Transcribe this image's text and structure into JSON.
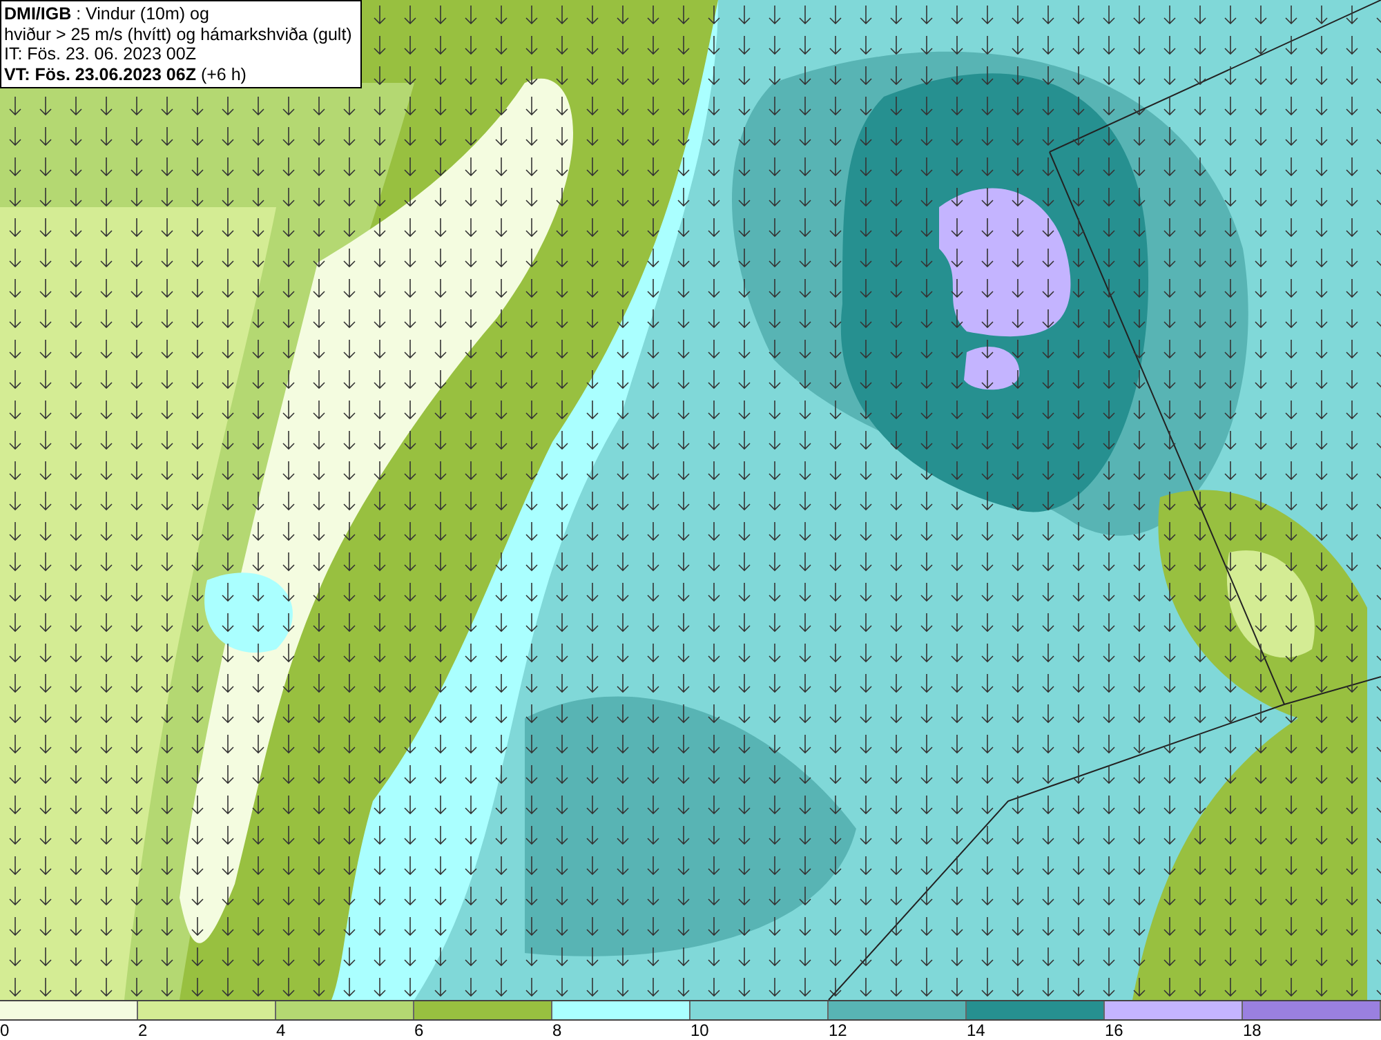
{
  "title_box": {
    "lines": [
      "**DMI/IGB** : Vindur (10m) og",
      "hviður > 25 m/s (hvítt) og hámarkshviða (gult)",
      "IT: Fös. 23. 06. 2023 00Z",
      "**VT: Fös. 23.06.2023 06Z** (+6 h)"
    ]
  },
  "legend": {
    "bins": [
      {
        "color": "#f4fce0",
        "label": "0"
      },
      {
        "color": "#d4ec94",
        "label": "2"
      },
      {
        "color": "#b4d872",
        "label": "4"
      },
      {
        "color": "#98c040",
        "label": "6"
      },
      {
        "color": "#aaffff",
        "label": "8"
      },
      {
        "color": "#80d8d8",
        "label": "10"
      },
      {
        "color": "#58b4b4",
        "label": "12"
      },
      {
        "color": "#269090",
        "label": "14"
      },
      {
        "color": "#c4b4ff",
        "label": "16"
      },
      {
        "color": "#9a80e0",
        "label": "18"
      }
    ]
  }
}
